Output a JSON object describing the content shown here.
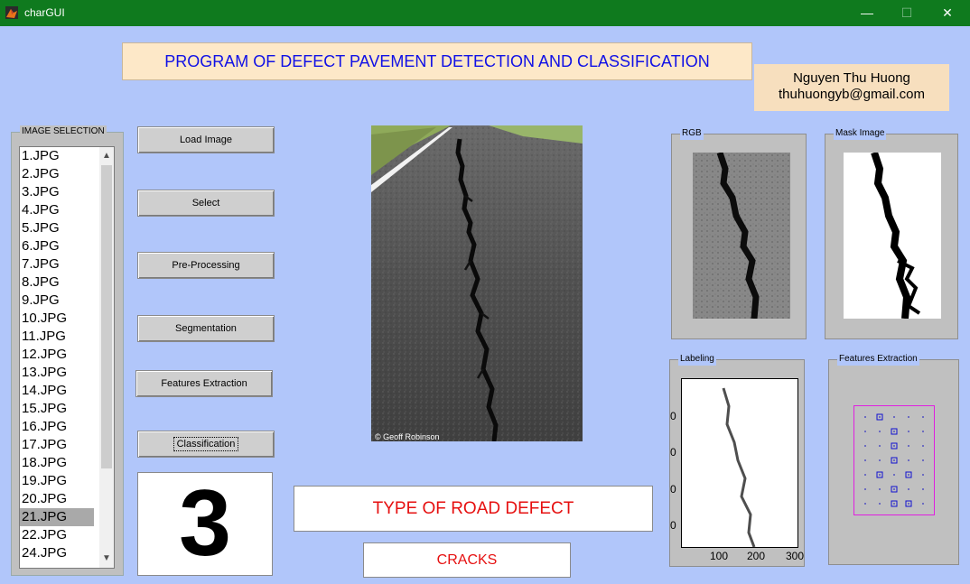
{
  "window": {
    "title": "charGUI",
    "minimize_glyph": "—",
    "maximize_glyph": "☐",
    "close_glyph": "✕"
  },
  "header": {
    "title": "PROGRAM OF DEFECT PAVEMENT DETECTION AND CLASSIFICATION",
    "author_name": "Nguyen Thu Huong",
    "author_email": "thuhuongyb@gmail.com"
  },
  "image_selection": {
    "label": "IMAGE SELECTION",
    "items": [
      "1.JPG",
      "2.JPG",
      "3.JPG",
      "4.JPG",
      "5.JPG",
      "6.JPG",
      "7.JPG",
      "8.JPG",
      "9.JPG",
      "10.JPG",
      "11.JPG",
      "12.JPG",
      "13.JPG",
      "14.JPG",
      "15.JPG",
      "16.JPG",
      "17.JPG",
      "18.JPG",
      "19.JPG",
      "20.JPG",
      "21.JPG",
      "22.JPG",
      "24.JPG"
    ],
    "selected_index": 20
  },
  "buttons": {
    "load": "Load Image",
    "select": "Select",
    "preprocess": "Pre-Processing",
    "segmentation": "Segmentation",
    "features": "Features Extraction",
    "classification": "Classification"
  },
  "result": {
    "class_number": "3",
    "type_label": "TYPE OF ROAD DEFECT",
    "type_value": "CRACKS"
  },
  "main_image": {
    "credit": "© Geoff Robinson"
  },
  "panels": {
    "rgb": "RGB",
    "mask": "Mask Image",
    "labeling": "Labeling",
    "features": "Features Extraction"
  },
  "labeling_axes": {
    "x_ticks": [
      "100",
      "200",
      "300"
    ],
    "y_ticks": [
      "0",
      "0",
      "0",
      "0"
    ]
  },
  "colors": {
    "background": "#b1c6fa",
    "titlebar": "#0f7a1e",
    "title_text": "#1010e6",
    "result_text": "#e61010"
  }
}
